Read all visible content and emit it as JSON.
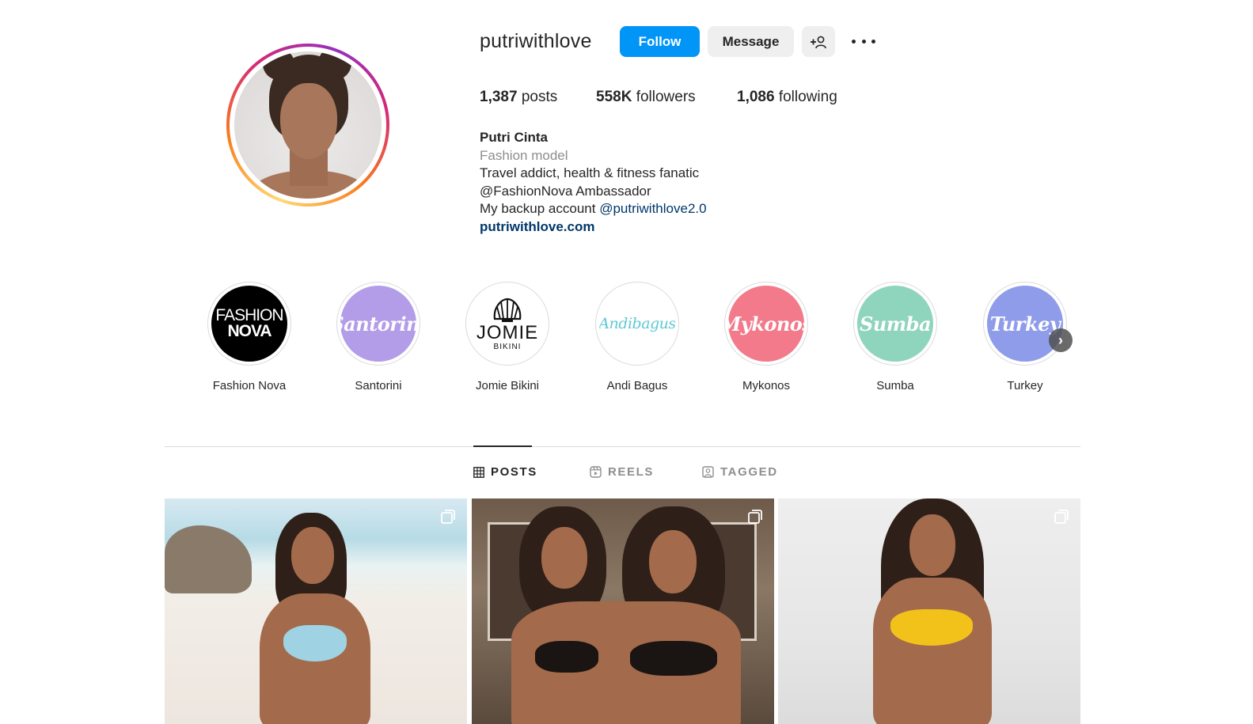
{
  "profile": {
    "username": "putriwithlove",
    "follow_label": "Follow",
    "message_label": "Message",
    "add_user_label": "+👤",
    "stats": {
      "posts_count": "1,387",
      "posts_label": " posts",
      "followers_count": "558K",
      "followers_label": " followers",
      "following_count": "1,086",
      "following_label": " following"
    },
    "bio": {
      "full_name": "Putri Cinta",
      "category": "Fashion model",
      "line1": "Travel addict, health & fitness fanatic",
      "line2": "@FashionNova Ambassador",
      "line3_prefix": "My backup account ",
      "line3_mention": "@putriwithlove2.0",
      "website": "putriwithlove.com"
    }
  },
  "highlights": [
    {
      "label": "Fashion Nova",
      "cover_line1": "FASHION",
      "cover_line2": "NOVA"
    },
    {
      "label": "Santorini",
      "cover_text": "Santorini"
    },
    {
      "label": "Jomie Bikini",
      "cover_line1": "JOMIE",
      "cover_line2": "BIKINI"
    },
    {
      "label": "Andi Bagus",
      "cover_text": "Andibagus"
    },
    {
      "label": "Mykonos",
      "cover_text": "Mykonos"
    },
    {
      "label": "Sumba",
      "cover_text": "Sumba"
    },
    {
      "label": "Turkey",
      "cover_text": "Turkey"
    }
  ],
  "tabs": [
    {
      "label": "POSTS",
      "active": true,
      "icon": "grid-icon"
    },
    {
      "label": "REELS",
      "active": false,
      "icon": "reels-icon"
    },
    {
      "label": "TAGGED",
      "active": false,
      "icon": "tagged-icon"
    }
  ],
  "colors": {
    "accent_blue": "#0095f6",
    "link_blue": "#00376b",
    "secondary_text": "#8e8e8e"
  }
}
